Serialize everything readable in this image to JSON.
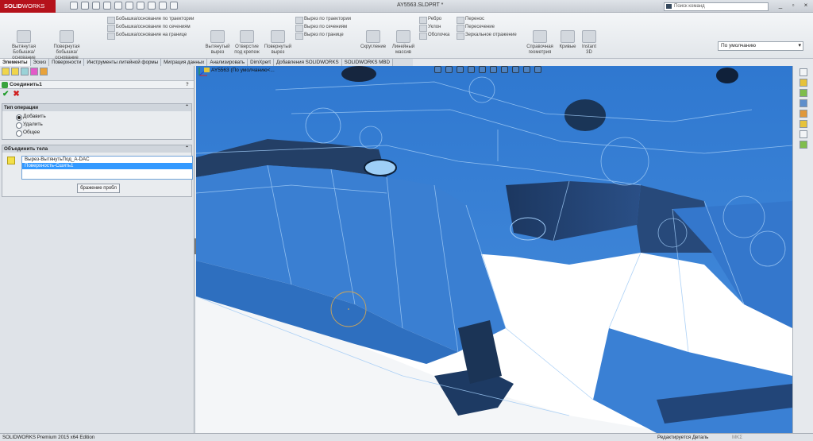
{
  "titlebar": {
    "logo_brand": "SOLID",
    "logo_suffix": "WORKS",
    "document_title": "AY5563.SLDPRT *",
    "search_placeholder": "Поиск команд",
    "win_minimize": "_",
    "win_restore": "▫",
    "win_close": "×"
  },
  "ribbon": {
    "extrude_boss": "Вытянутая Бобышка/основание",
    "revolve_boss": "Повернутая бобышка/основание",
    "swept_boss": "Бобышка/основание по траектории",
    "lofted_boss": "Бобышка/основание по сечениям",
    "boundary_boss": "Бобышка/основание на границе",
    "extrude_cut": "Вытянутый вырез",
    "hole_wizard": "Отверстие под крепеж",
    "revolve_cut": "Повернутый вырез",
    "swept_cut": "Вырез по траектории",
    "lofted_cut": "Вырез по сечениям",
    "boundary_cut": "Вырез по границе",
    "fillet": "Скругление",
    "linear_pattern": "Линейный массив",
    "rib": "Ребро",
    "draft": "Уклон",
    "shell": "Оболочка",
    "wrap": "Перенос",
    "intersect": "Пересечение",
    "mirror": "Зеркальное отражение",
    "ref_geometry": "Справочная геометрия",
    "curves": "Кривые",
    "instant3d": "Instant 3D",
    "config_select": "По умолчанию"
  },
  "tabs": [
    {
      "label": "Элементы"
    },
    {
      "label": "Эскиз"
    },
    {
      "label": "Поверхности"
    },
    {
      "label": "Инструменты литейной формы"
    },
    {
      "label": "Миграция данных"
    },
    {
      "label": "Анализировать"
    },
    {
      "label": "DimXpert"
    },
    {
      "label": "Добавления SOLIDWORKS"
    },
    {
      "label": "SOLIDWORKS MBD"
    }
  ],
  "property_manager": {
    "feature_title": "Соединить1",
    "help": "?",
    "ok": "✔",
    "cancel": "✖",
    "operation_group": {
      "title": "Тип операции",
      "options": [
        {
          "label": "Добавить",
          "checked": true
        },
        {
          "label": "Удалить",
          "checked": false
        },
        {
          "label": "Общее",
          "checked": false
        }
      ]
    },
    "bodies_group": {
      "title": "Объединить тела",
      "items": [
        {
          "label": "Вырез-ВытянутьПод_А-DAC",
          "selected": false
        },
        {
          "label": "Поверхность-Сшить1",
          "selected": true
        }
      ],
      "button_label": "бражение пробл"
    }
  },
  "viewport": {
    "tree_label": "AY5563 (По умолчанию<..."
  },
  "statusbar": {
    "edition": "SOLIDWORKS Premium 2015 x64 Edition",
    "editing": "Редактируется Деталь",
    "units": "ΜΚΣ"
  },
  "colors": {
    "brand_red": "#b5121b",
    "model_blue": "#3f86d8",
    "model_dark": "#1f3d63",
    "edge_light": "#9ec9f5"
  }
}
